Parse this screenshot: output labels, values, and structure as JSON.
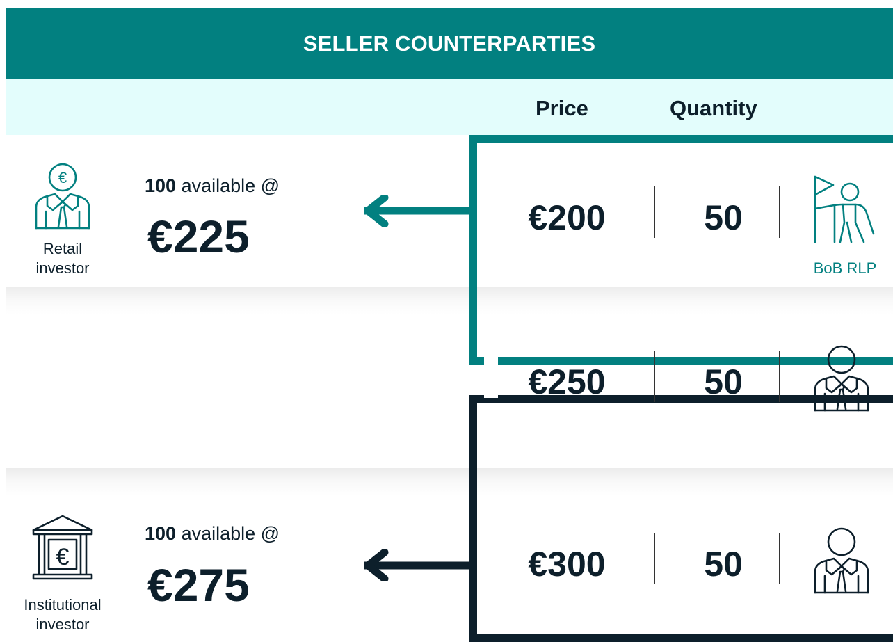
{
  "header": {
    "title": "SELLER COUNTERPARTIES"
  },
  "columns": {
    "price": "Price",
    "quantity": "Quantity"
  },
  "sellers": [
    {
      "name": "Retail investor",
      "line1": "Retail",
      "line2": "investor",
      "available_qty": "100",
      "available_text": " available @",
      "price": "€225",
      "icon": "retail-investor-icon"
    },
    {
      "name": "Institutional investor",
      "line1": "Institutional",
      "line2": "investor",
      "available_qty": "100",
      "available_text": " available @",
      "price": "€275",
      "icon": "institutional-investor-icon"
    }
  ],
  "orders": [
    {
      "price": "€200",
      "quantity": "50",
      "counterparty_label": "BoB RLP",
      "icon": "flag-person-icon"
    },
    {
      "price": "€250",
      "quantity": "50",
      "counterparty_label": "",
      "icon": "investor-person-icon"
    },
    {
      "price": "€300",
      "quantity": "50",
      "counterparty_label": "",
      "icon": "investor-person-icon"
    }
  ],
  "colors": {
    "accent": "#028080",
    "dark": "#0d1f2b",
    "header_band": "#e3fdfc"
  }
}
